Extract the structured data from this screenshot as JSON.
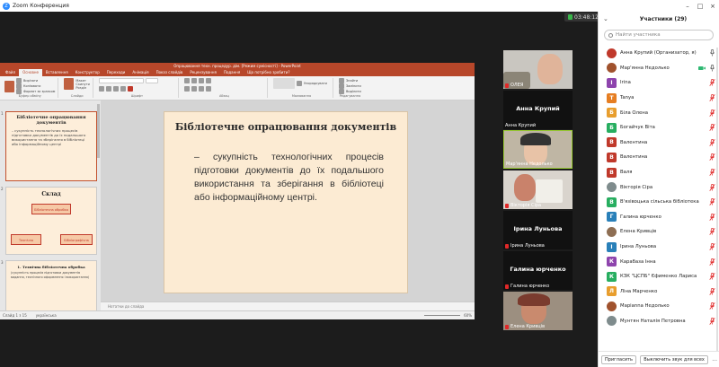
{
  "zoom": {
    "window_title": "Zoom Конференция",
    "timer": "03:48:12"
  },
  "ppt": {
    "window_title": "Опрацювання техн. процедур. дiм. [Режим сумiсностi] - PowerPoint",
    "tabs": [
      "Файл",
      "Основне",
      "Вставлення",
      "Конструктор",
      "Переходи",
      "Анімація",
      "Показ слайдів",
      "Рецензування",
      "Подання",
      "Що потрібно зробити?"
    ],
    "active_tab": "Основне",
    "ribbon": {
      "paste": "Вставити",
      "cut": "Вирізати",
      "copy": "Копіювати",
      "format": "Формат за зразком",
      "new_slide": "Створити слайд",
      "layout": "Макет",
      "reset": "Скинути",
      "section": "Розділ",
      "arrange": "Упорядкувати",
      "find": "Знайти",
      "replace": "Замінити",
      "select": "Виділити",
      "g_clipboard": "Буфер обміну",
      "g_slides": "Слайди",
      "g_font": "Шрифт",
      "g_paragraph": "Абзац",
      "g_drawing": "Малювання",
      "g_editing": "Редагування"
    },
    "thumbs": {
      "n1": "1",
      "n2": "2",
      "n3": "3",
      "s1_title": "Бібліотечне опрацювання документів",
      "s1_text": "– сукупність технологічних процесів підготовки документів до їх подальшого використання та зберігання в бібліотеці або інформаційному центрі",
      "s2_title": "Склад",
      "s2_box1": "Бібліотечна обробка",
      "s2_box2": "Технічна",
      "s2_box3": "Бібліографічна",
      "s3_title": "1. Технічна бібліотечна обробка",
      "s3_text": "(сукупність процесів підготовки документів видання, технічного оформлення і використання)"
    },
    "slide": {
      "title": "Бібліотечне опрацювання документів",
      "text": "– сукупність технологічних процесів підготовки документів до їх подальшого використання та зберігання в бібліотеці або інформаційному центрі."
    },
    "notes_placeholder": "Нотатки до слайда",
    "status_left": "Слайд 1 з 15",
    "status_lang": "українська",
    "zoom_level": "60%"
  },
  "video_tiles": [
    {
      "name": "ОЛЕЯ",
      "label_big": ""
    },
    {
      "name": "Анна Крупий",
      "label_big": "Анна Крупий"
    },
    {
      "name": "Мар'янна Недолько",
      "label_big": ""
    },
    {
      "name": "Вікторія Сіра",
      "label_big": ""
    },
    {
      "name": "Ірина Луньова",
      "label_big": "Ірина Луньова"
    },
    {
      "name": "Галина юрченко",
      "label_big": "Галина юрченко"
    },
    {
      "name": "Елена Кривців",
      "label_big": ""
    }
  ],
  "participants": {
    "title": "Участники (29)",
    "search_placeholder": "Найти участника",
    "list": [
      {
        "name": "Анна Крупий (Организатор, я)",
        "initial": "",
        "color": "#c0392b",
        "photo": true,
        "muted": false,
        "video_on": false
      },
      {
        "name": "Мар'янна Недолько",
        "initial": "",
        "color": "#a0522d",
        "photo": true,
        "muted": false,
        "video_on": true
      },
      {
        "name": "Irina",
        "initial": "I",
        "color": "#8e44ad",
        "photo": false,
        "muted": true,
        "video_on": false
      },
      {
        "name": "Tanya",
        "initial": "T",
        "color": "#e67e22",
        "photo": false,
        "muted": true,
        "video_on": false
      },
      {
        "name": "Біла Олена",
        "initial": "Б",
        "color": "#e89e2e",
        "photo": false,
        "muted": true,
        "video_on": false
      },
      {
        "name": "Богайчук Віта",
        "initial": "Б",
        "color": "#27ae60",
        "photo": false,
        "muted": true,
        "video_on": false
      },
      {
        "name": "Валентина",
        "initial": "В",
        "color": "#c0392b",
        "photo": false,
        "muted": true,
        "video_on": false
      },
      {
        "name": "Валентина",
        "initial": "В",
        "color": "#c0392b",
        "photo": false,
        "muted": true,
        "video_on": false
      },
      {
        "name": "Валя",
        "initial": "В",
        "color": "#c0392b",
        "photo": false,
        "muted": true,
        "video_on": false
      },
      {
        "name": "Вікторія Сіра",
        "initial": "",
        "color": "#7f8c8d",
        "photo": true,
        "muted": true,
        "video_on": false
      },
      {
        "name": "В'язівоцька сільська бібліотека",
        "initial": "В",
        "color": "#27ae60",
        "photo": false,
        "muted": true,
        "video_on": false
      },
      {
        "name": "Галина юрченко",
        "initial": "Г",
        "color": "#2980b9",
        "photo": false,
        "muted": true,
        "video_on": false
      },
      {
        "name": "Елена Кривців",
        "initial": "",
        "color": "#8e6e53",
        "photo": true,
        "muted": true,
        "video_on": false
      },
      {
        "name": "Ірина Луньова",
        "initial": "І",
        "color": "#2980b9",
        "photo": false,
        "muted": true,
        "video_on": false
      },
      {
        "name": "Карабаза Інна",
        "initial": "К",
        "color": "#8e44ad",
        "photo": false,
        "muted": true,
        "video_on": false
      },
      {
        "name": "КЗК \"ЦСПБ\" Єфименко Лариса",
        "initial": "К",
        "color": "#27ae60",
        "photo": false,
        "muted": true,
        "video_on": false
      },
      {
        "name": "Ліна Марченко",
        "initial": "Л",
        "color": "#e89e2e",
        "photo": false,
        "muted": true,
        "video_on": false
      },
      {
        "name": "Марianna Недолько",
        "initial": "",
        "color": "#a0522d",
        "photo": true,
        "muted": true,
        "video_on": false
      },
      {
        "name": "Мунтян Наталія Петровна",
        "initial": "",
        "color": "#7f8c8d",
        "photo": true,
        "muted": true,
        "video_on": false
      }
    ],
    "invite_button": "Пригласить",
    "mute_all_button": "Выключить звук для всех",
    "more_button": "..."
  }
}
